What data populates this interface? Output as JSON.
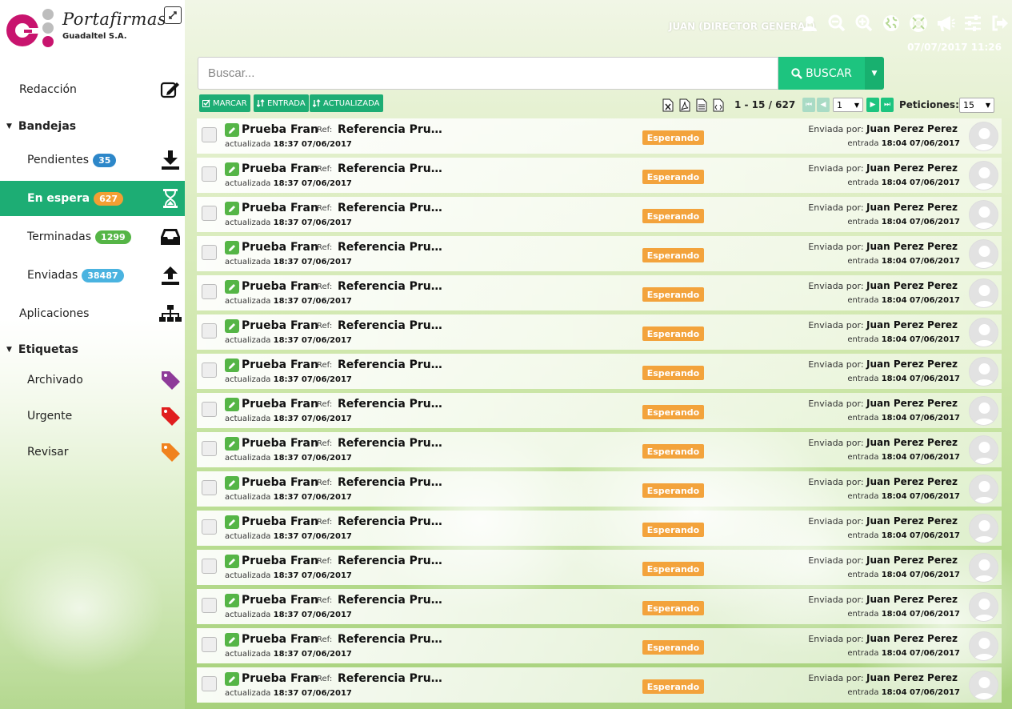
{
  "brand": {
    "name": "Portafirmas",
    "company": "Guadaltel S.A."
  },
  "header": {
    "user": "JUAN (DIRECTOR GENERAL)",
    "datetime": "07/07/2017 11:26"
  },
  "sidebar": {
    "redaccion": "Redacción",
    "bandejas": "Bandejas",
    "items": [
      {
        "label": "Pendientes",
        "count": "35"
      },
      {
        "label": "En espera",
        "count": "627"
      },
      {
        "label": "Terminadas",
        "count": "1299"
      },
      {
        "label": "Enviadas",
        "count": "38487"
      }
    ],
    "aplicaciones": "Aplicaciones",
    "etiquetas": "Etiquetas",
    "tags": [
      {
        "label": "Archivado",
        "color": "#8e3b99"
      },
      {
        "label": "Urgente",
        "color": "#e01e1e"
      },
      {
        "label": "Revisar",
        "color": "#f0821e"
      }
    ]
  },
  "search": {
    "placeholder": "Buscar...",
    "button": "BUSCAR"
  },
  "toolbar": {
    "marcar": "MARCAR",
    "entrada": "ENTRADA",
    "actualizada": "ACTUALIZADA",
    "range": "1 - 15 / 627",
    "page": "1",
    "peticiones_label": "Peticiones:",
    "peticiones": "15"
  },
  "rows": [
    {
      "subject": "Prueba Fran",
      "ref_label": "Ref:",
      "ref": "Referencia Prueba",
      "upd_label": "actualizada",
      "upd": "18:37 07/06/2017",
      "status": "Esperando",
      "sent_label": "Enviada por:",
      "sender": "Juan Perez Perez",
      "entr_label": "entrada",
      "entr": "18:04 07/06/2017"
    },
    {
      "subject": "Prueba Fran",
      "ref_label": "Ref:",
      "ref": "Referencia Prueba",
      "upd_label": "actualizada",
      "upd": "18:37 07/06/2017",
      "status": "Esperando",
      "sent_label": "Enviada por:",
      "sender": "Juan Perez Perez",
      "entr_label": "entrada",
      "entr": "18:04 07/06/2017"
    },
    {
      "subject": "Prueba Fran",
      "ref_label": "Ref:",
      "ref": "Referencia Prueba",
      "upd_label": "actualizada",
      "upd": "18:37 07/06/2017",
      "status": "Esperando",
      "sent_label": "Enviada por:",
      "sender": "Juan Perez Perez",
      "entr_label": "entrada",
      "entr": "18:04 07/06/2017"
    },
    {
      "subject": "Prueba Fran",
      "ref_label": "Ref:",
      "ref": "Referencia Prueba",
      "upd_label": "actualizada",
      "upd": "18:37 07/06/2017",
      "status": "Esperando",
      "sent_label": "Enviada por:",
      "sender": "Juan Perez Perez",
      "entr_label": "entrada",
      "entr": "18:04 07/06/2017"
    },
    {
      "subject": "Prueba Fran",
      "ref_label": "Ref:",
      "ref": "Referencia Prueba",
      "upd_label": "actualizada",
      "upd": "18:37 07/06/2017",
      "status": "Esperando",
      "sent_label": "Enviada por:",
      "sender": "Juan Perez Perez",
      "entr_label": "entrada",
      "entr": "18:04 07/06/2017"
    },
    {
      "subject": "Prueba Fran",
      "ref_label": "Ref:",
      "ref": "Referencia Prueba",
      "upd_label": "actualizada",
      "upd": "18:37 07/06/2017",
      "status": "Esperando",
      "sent_label": "Enviada por:",
      "sender": "Juan Perez Perez",
      "entr_label": "entrada",
      "entr": "18:04 07/06/2017"
    },
    {
      "subject": "Prueba Fran",
      "ref_label": "Ref:",
      "ref": "Referencia Prueba",
      "upd_label": "actualizada",
      "upd": "18:37 07/06/2017",
      "status": "Esperando",
      "sent_label": "Enviada por:",
      "sender": "Juan Perez Perez",
      "entr_label": "entrada",
      "entr": "18:04 07/06/2017"
    },
    {
      "subject": "Prueba Fran",
      "ref_label": "Ref:",
      "ref": "Referencia Prueba",
      "upd_label": "actualizada",
      "upd": "18:37 07/06/2017",
      "status": "Esperando",
      "sent_label": "Enviada por:",
      "sender": "Juan Perez Perez",
      "entr_label": "entrada",
      "entr": "18:04 07/06/2017"
    },
    {
      "subject": "Prueba Fran",
      "ref_label": "Ref:",
      "ref": "Referencia Prueba",
      "upd_label": "actualizada",
      "upd": "18:37 07/06/2017",
      "status": "Esperando",
      "sent_label": "Enviada por:",
      "sender": "Juan Perez Perez",
      "entr_label": "entrada",
      "entr": "18:04 07/06/2017"
    },
    {
      "subject": "Prueba Fran",
      "ref_label": "Ref:",
      "ref": "Referencia Prueba",
      "upd_label": "actualizada",
      "upd": "18:37 07/06/2017",
      "status": "Esperando",
      "sent_label": "Enviada por:",
      "sender": "Juan Perez Perez",
      "entr_label": "entrada",
      "entr": "18:04 07/06/2017"
    },
    {
      "subject": "Prueba Fran",
      "ref_label": "Ref:",
      "ref": "Referencia Prueba",
      "upd_label": "actualizada",
      "upd": "18:37 07/06/2017",
      "status": "Esperando",
      "sent_label": "Enviada por:",
      "sender": "Juan Perez Perez",
      "entr_label": "entrada",
      "entr": "18:04 07/06/2017"
    },
    {
      "subject": "Prueba Fran",
      "ref_label": "Ref:",
      "ref": "Referencia Prueba",
      "upd_label": "actualizada",
      "upd": "18:37 07/06/2017",
      "status": "Esperando",
      "sent_label": "Enviada por:",
      "sender": "Juan Perez Perez",
      "entr_label": "entrada",
      "entr": "18:04 07/06/2017"
    },
    {
      "subject": "Prueba Fran",
      "ref_label": "Ref:",
      "ref": "Referencia Prueba",
      "upd_label": "actualizada",
      "upd": "18:37 07/06/2017",
      "status": "Esperando",
      "sent_label": "Enviada por:",
      "sender": "Juan Perez Perez",
      "entr_label": "entrada",
      "entr": "18:04 07/06/2017"
    },
    {
      "subject": "Prueba Fran",
      "ref_label": "Ref:",
      "ref": "Referencia Prueba",
      "upd_label": "actualizada",
      "upd": "18:37 07/06/2017",
      "status": "Esperando",
      "sent_label": "Enviada por:",
      "sender": "Juan Perez Perez",
      "entr_label": "entrada",
      "entr": "18:04 07/06/2017"
    },
    {
      "subject": "Prueba Fran",
      "ref_label": "Ref:",
      "ref": "Referencia Prueba",
      "upd_label": "actualizada",
      "upd": "18:37 07/06/2017",
      "status": "Esperando",
      "sent_label": "Enviada por:",
      "sender": "Juan Perez Perez",
      "entr_label": "entrada",
      "entr": "18:04 07/06/2017"
    }
  ]
}
